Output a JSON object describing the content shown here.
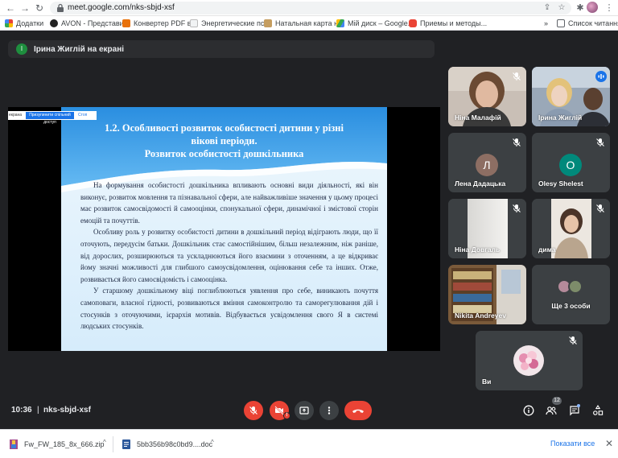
{
  "browser": {
    "url": "meet.google.com/nks-sbjd-xsf",
    "bookmarks": [
      {
        "label": "Додатки",
        "color": "#4285f4"
      },
      {
        "label": "AVON - Представи...",
        "color": "#222222"
      },
      {
        "label": "Конвертер PDF в...",
        "color": "#e8710a"
      },
      {
        "label": "Энергетические пс...",
        "color": "#bbbbbb"
      },
      {
        "label": "Натальная карта н...",
        "color": "#c59d5f"
      },
      {
        "label": "Мій диск – Google...",
        "color": "#34a853"
      },
      {
        "label": "Приемы и методы...",
        "color": "#ea4335"
      }
    ],
    "more_bookmarks": "»",
    "reading_list": "Список читання"
  },
  "meet": {
    "presenter_initial": "І",
    "presenter_text": "Ірина Жиглій на екрані",
    "slide": {
      "toolbar_left": "екрана",
      "toolbar_button": "Призупинити спільний доступ",
      "toolbar_right": "Стоп",
      "title_line1": "1.2. Особливості розвиток особистості дитини у різні",
      "title_line2": "вікові періоди.",
      "title_line3": "Розвиток особистості дошкільника",
      "paragraphs": [
        "На формування особистості дошкільника впливають основні види діяльності, які він виконує, розвиток мовлення та пізнавальної сфери, але найважливіше значення у цьому процесі має розвиток самосвідомості й самооцінки, спонукальної сфери, динамічної і змістової сторін емоцій та почуттів.",
        "Особливу роль у розвитку особистості дитини в дошкільний період відіграють люди, що її оточують, передусім батьки. Дошкільник стає самостійнішим, більш незалежним, ніж раніше, від дорослих, розширюються та ускладнюються його взаємини з оточенням, а це відкриває йому значні можливості для глибшого самоусвідомлення, оцінювання себе та інших. Отже, розвивається його самосвідомість і самооцінка.",
        "У старшому дошкільному віці поглиблюються уявлення про себе, виникають почуття самоповаги, власної гідності, розвиваються вміння самоконтролю та саморегулювання дій і стосунків з оточуючими, ієрархія мотивів. Відбувається усвідомлення свого Я в системі людських стосунків."
      ]
    },
    "participants": [
      {
        "name": "Ніна Малафій"
      },
      {
        "name": "Ірина Жиглій"
      },
      {
        "name": "Лена Дадацька",
        "initial": "Л",
        "color": "#8d6e63"
      },
      {
        "name": "Olesy Shelest",
        "initial": "O",
        "color": "#00897b"
      },
      {
        "name": "Ніна Довгаль"
      },
      {
        "name": "дима"
      },
      {
        "name": "Nikita Andreyev"
      },
      {
        "name": "Ще 3 особи"
      },
      {
        "name": "Ви"
      }
    ],
    "clock": "10:36",
    "separator": "|",
    "meeting_code": "nks-sbjd-xsf",
    "camera_warning": "!",
    "people_count": "12"
  },
  "downloads": {
    "items": [
      {
        "name": "Fw_FW_185_8x_666.zip"
      },
      {
        "name": "5bb356b98c0bd9....doc"
      }
    ],
    "chevron": "^",
    "show_all": "Показати все",
    "close": "✕"
  }
}
